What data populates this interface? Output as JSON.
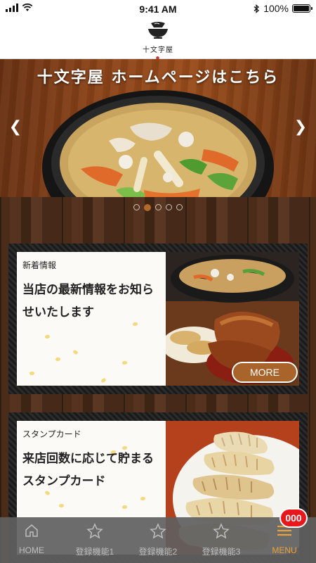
{
  "status_bar": {
    "time": "9:41 AM",
    "battery": "100%",
    "icons": [
      "signal-icon",
      "wifi-icon",
      "bluetooth-icon",
      "battery-icon"
    ]
  },
  "header": {
    "logo_text": "十文字屋",
    "logo_icon": "ramen-bowl-icon"
  },
  "hero": {
    "title": "十文字屋 ホームページはこちら",
    "prev_icon": "chevron-left-icon",
    "next_icon": "chevron-right-icon",
    "slide_count": 5,
    "active_slide": 2
  },
  "cards": [
    {
      "label": "新着情報",
      "body": "当店の最新情報をお知らせいたします",
      "button": "MORE",
      "photo": "ramen-and-fried-food-photo"
    },
    {
      "label": "スタンプカード",
      "body": "来店回数に応じて貯まるスタンプカード",
      "photo": "gyoza-photo"
    }
  ],
  "tab_bar": {
    "items": [
      {
        "label": "HOME",
        "icon": "home-icon"
      },
      {
        "label": "登録機能1",
        "icon": "star-icon"
      },
      {
        "label": "登録機能2",
        "icon": "star-icon"
      },
      {
        "label": "登録機能3",
        "icon": "star-icon"
      },
      {
        "label": "MENU",
        "icon": "menu-icon"
      }
    ],
    "badge": "000"
  },
  "colors": {
    "accent": "#a8642a",
    "menu_active": "#e8a23a",
    "badge": "#e8171c",
    "tab_bar_bg": "#5f5f5f"
  }
}
